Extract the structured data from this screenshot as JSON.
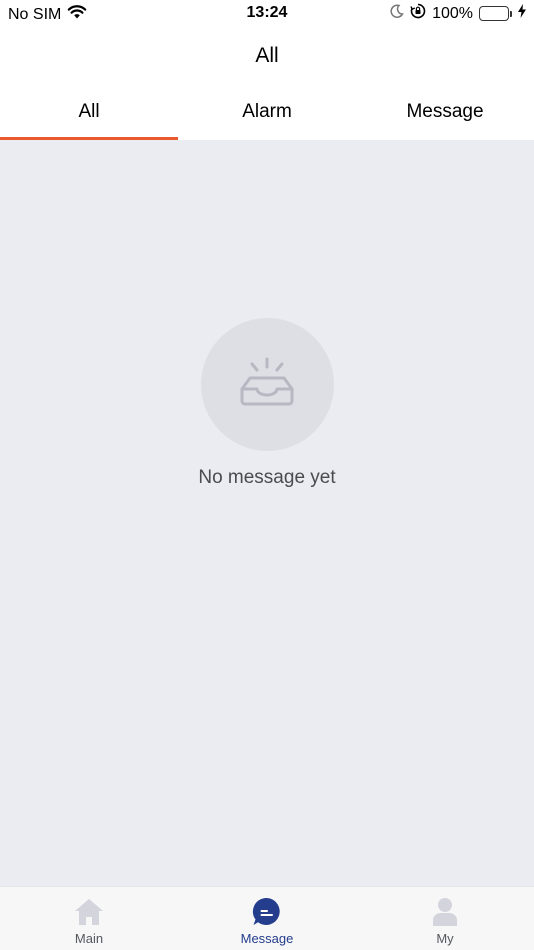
{
  "status_bar": {
    "carrier": "No SIM",
    "time": "13:24",
    "battery_percent": "100%",
    "battery_level": 1.0,
    "icons": [
      "wifi-icon",
      "moon-icon",
      "orientation-lock-icon",
      "battery-icon",
      "charging-icon"
    ]
  },
  "nav": {
    "title": "All"
  },
  "tabs": [
    {
      "label": "All",
      "active": true
    },
    {
      "label": "Alarm",
      "active": false
    },
    {
      "label": "Message",
      "active": false
    }
  ],
  "empty_state": {
    "icon": "inbox-icon",
    "text": "No message yet"
  },
  "bottom_nav": [
    {
      "label": "Main",
      "icon": "home-icon",
      "active": false
    },
    {
      "label": "Message",
      "icon": "message-icon",
      "active": true
    },
    {
      "label": "My",
      "icon": "user-icon",
      "active": false
    }
  ],
  "colors": {
    "accent": "#e9592f",
    "active_nav": "#243d8d",
    "inactive_icon": "#d3d4dc",
    "background": "#ebecf1",
    "battery": "#4cd964"
  }
}
